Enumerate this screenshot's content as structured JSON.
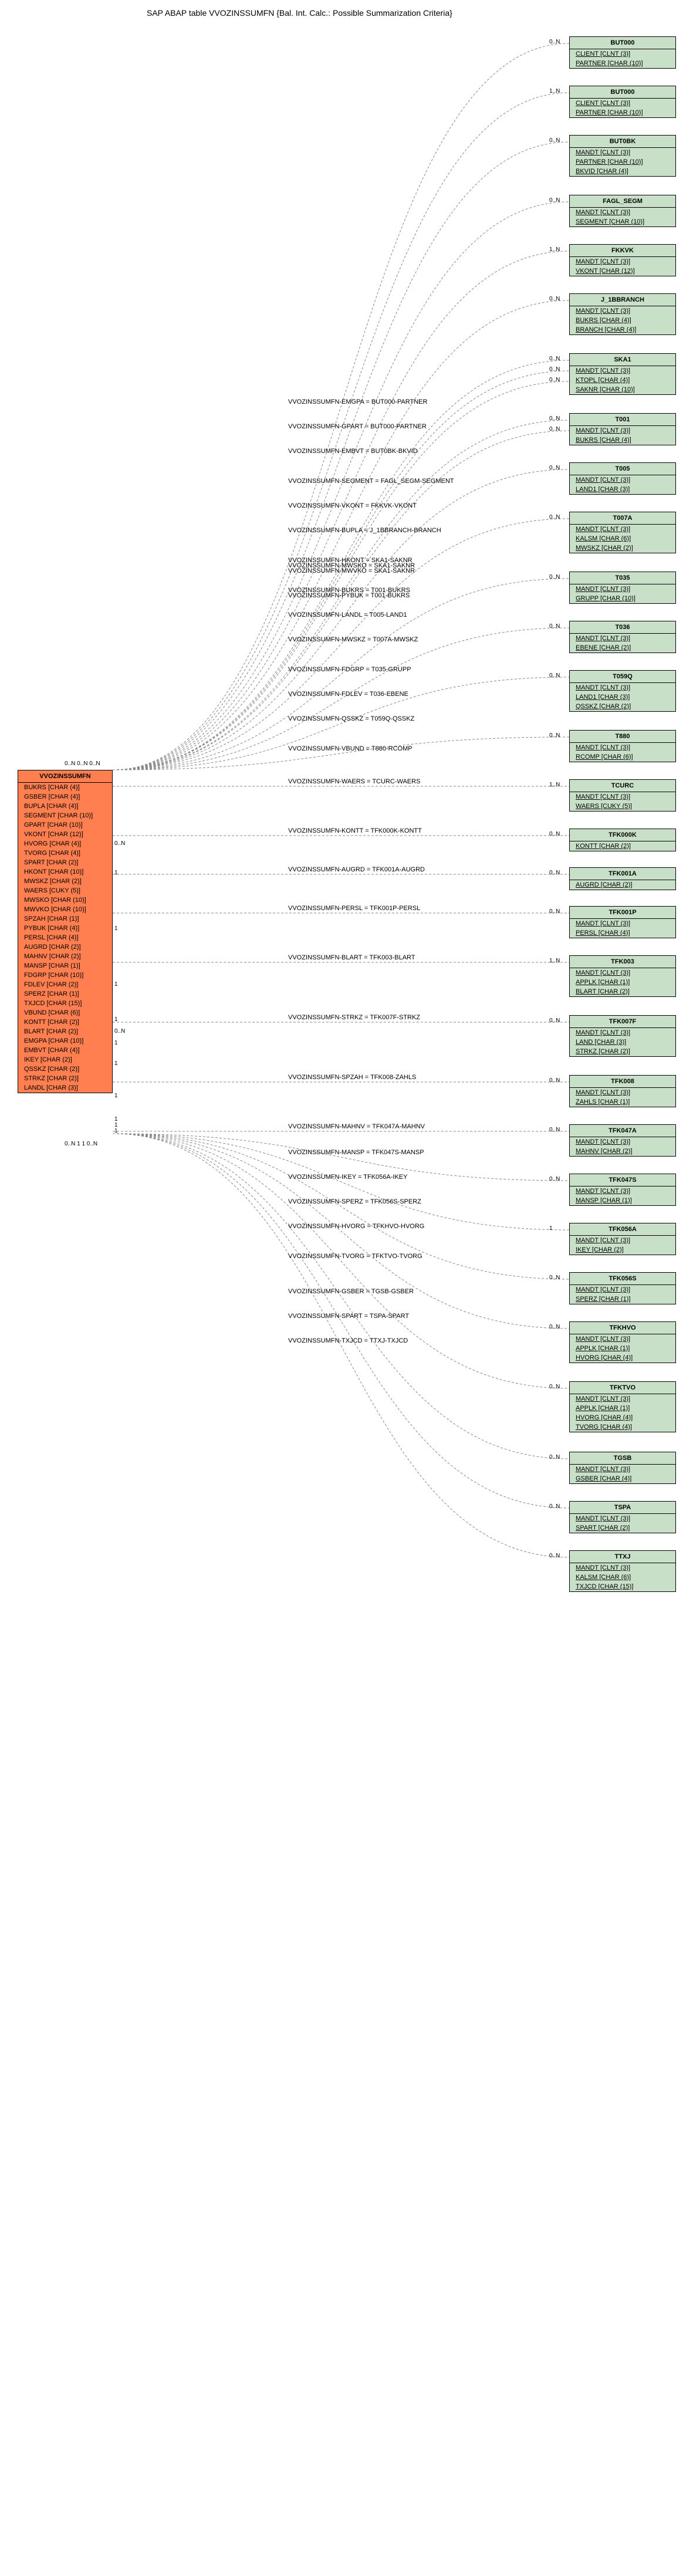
{
  "title": "SAP ABAP table VVOZINSSUMFN {Bal. Int. Calc.: Possible Summarization Criteria}",
  "main": {
    "name": "VVOZINSSUMFN",
    "fields": [
      "BUKRS [CHAR (4)]",
      "GSBER [CHAR (4)]",
      "BUPLA [CHAR (4)]",
      "SEGMENT [CHAR (10)]",
      "GPART [CHAR (10)]",
      "VKONT [CHAR (12)]",
      "HVORG [CHAR (4)]",
      "TVORG [CHAR (4)]",
      "SPART [CHAR (2)]",
      "HKONT [CHAR (10)]",
      "MWSKZ [CHAR (2)]",
      "WAERS [CUKY (5)]",
      "MWSKO [CHAR (10)]",
      "MWVKO [CHAR (10)]",
      "SPZAH [CHAR (1)]",
      "PYBUK [CHAR (4)]",
      "PERSL [CHAR (4)]",
      "AUGRD [CHAR (2)]",
      "MAHNV [CHAR (2)]",
      "MANSP [CHAR (1)]",
      "FDGRP [CHAR (10)]",
      "FDLEV [CHAR (2)]",
      "SPERZ [CHAR (1)]",
      "TXJCD [CHAR (15)]",
      "VBUND [CHAR (6)]",
      "KONTT [CHAR (2)]",
      "BLART [CHAR (2)]",
      "EMGPA [CHAR (10)]",
      "EMBVT [CHAR (4)]",
      "IKEY [CHAR (2)]",
      "QSSKZ [CHAR (2)]",
      "STRKZ [CHAR (2)]",
      "LANDL [CHAR (3)]"
    ]
  },
  "targets": [
    {
      "name": "BUT000",
      "fields": [
        "CLIENT [CLNT (3)]",
        "PARTNER [CHAR (10)]"
      ],
      "card": "0..N",
      "rel": "VVOZINSSUMFN-EMGPA = BUT000-PARTNER"
    },
    {
      "name": "BUT000",
      "fields": [
        "CLIENT [CLNT (3)]",
        "PARTNER [CHAR (10)]"
      ],
      "card": "1..N",
      "rel": "VVOZINSSUMFN-GPART = BUT000-PARTNER"
    },
    {
      "name": "BUT0BK",
      "fields": [
        "MANDT [CLNT (3)]",
        "PARTNER [CHAR (10)]",
        "BKVID [CHAR (4)]"
      ],
      "card": "0..N",
      "rel": "VVOZINSSUMFN-EMBVT = BUT0BK-BKVID"
    },
    {
      "name": "FAGL_SEGM",
      "fields": [
        "MANDT [CLNT (3)]",
        "SEGMENT [CHAR (10)]"
      ],
      "card": "0..N",
      "rel": "VVOZINSSUMFN-SEGMENT = FAGL_SEGM-SEGMENT"
    },
    {
      "name": "FKKVK",
      "fields": [
        "MANDT [CLNT (3)]",
        "VKONT [CHAR (12)]"
      ],
      "card": "1..N",
      "rel": "VVOZINSSUMFN-VKONT = FKKVK-VKONT"
    },
    {
      "name": "J_1BBRANCH",
      "fields": [
        "MANDT [CLNT (3)]",
        "BUKRS [CHAR (4)]",
        "BRANCH [CHAR (4)]"
      ],
      "card": "0..N",
      "rel": "VVOZINSSUMFN-BUPLA = J_1BBRANCH-BRANCH"
    },
    {
      "name": "SKA1",
      "fields": [
        "MANDT [CLNT (3)]",
        "KTOPL [CHAR (4)]",
        "SAKNR [CHAR (10)]"
      ],
      "card": [
        "0..N",
        "0..N",
        "0..N"
      ],
      "rel": [
        "VVOZINSSUMFN-HKONT = SKA1-SAKNR",
        "VVOZINSSUMFN-MWSKO = SKA1-SAKNR",
        "VVOZINSSUMFN-MWVKO = SKA1-SAKNR"
      ]
    },
    {
      "name": "T001",
      "fields": [
        "MANDT [CLNT (3)]",
        "BUKRS [CHAR (4)]"
      ],
      "card": [
        "0..N",
        "0..N"
      ],
      "rel": [
        "VVOZINSSUMFN-BUKRS = T001-BUKRS",
        "VVOZINSSUMFN-PYBUK = T001-BUKRS"
      ]
    },
    {
      "name": "T005",
      "fields": [
        "MANDT [CLNT (3)]",
        "LAND1 [CHAR (3)]"
      ],
      "card": "0..N",
      "rel": "VVOZINSSUMFN-LANDL = T005-LAND1"
    },
    {
      "name": "T007A",
      "fields": [
        "MANDT [CLNT (3)]",
        "KALSM [CHAR (6)]",
        "MWSKZ [CHAR (2)]"
      ],
      "card": "0..N",
      "rel": "VVOZINSSUMFN-MWSKZ = T007A-MWSKZ"
    },
    {
      "name": "T035",
      "fields": [
        "MANDT [CLNT (3)]",
        "GRUPP [CHAR (10)]"
      ],
      "card": "0..N",
      "rel": "VVOZINSSUMFN-FDGRP = T035-GRUPP"
    },
    {
      "name": "T036",
      "fields": [
        "MANDT [CLNT (3)]",
        "EBENE [CHAR (2)]"
      ],
      "card": "0..N",
      "rel": "VVOZINSSUMFN-FDLEV = T036-EBENE"
    },
    {
      "name": "T059Q",
      "fields": [
        "MANDT [CLNT (3)]",
        "LAND1 [CHAR (3)]",
        "QSSKZ [CHAR (2)]"
      ],
      "card": "0..N",
      "rel": "VVOZINSSUMFN-QSSKZ = T059Q-QSSKZ"
    },
    {
      "name": "T880",
      "fields": [
        "MANDT [CLNT (3)]",
        "RCOMP [CHAR (6)]"
      ],
      "card": "0..N",
      "rel": "VVOZINSSUMFN-VBUND = T880-RCOMP"
    },
    {
      "name": "TCURC",
      "fields": [
        "MANDT [CLNT (3)]",
        "WAERS [CUKY (5)]"
      ],
      "card": "1..N",
      "rel": "VVOZINSSUMFN-WAERS = TCURC-WAERS"
    },
    {
      "name": "TFK000K",
      "fields": [
        "KONTT [CHAR (2)]"
      ],
      "card": "0..N",
      "rel": "VVOZINSSUMFN-KONTT = TFK000K-KONTT"
    },
    {
      "name": "TFK001A",
      "fields": [
        "AUGRD [CHAR (2)]"
      ],
      "card": "0..N",
      "rel": "VVOZINSSUMFN-AUGRD = TFK001A-AUGRD"
    },
    {
      "name": "TFK001P",
      "fields": [
        "MANDT [CLNT (3)]",
        "PERSL [CHAR (4)]"
      ],
      "card": "0..N",
      "rel": "VVOZINSSUMFN-PERSL = TFK001P-PERSL"
    },
    {
      "name": "TFK003",
      "fields": [
        "MANDT [CLNT (3)]",
        "APPLK [CHAR (1)]",
        "BLART [CHAR (2)]"
      ],
      "card": "1..N",
      "rel": "VVOZINSSUMFN-BLART = TFK003-BLART"
    },
    {
      "name": "TFK007F",
      "fields": [
        "MANDT [CLNT (3)]",
        "LAND [CHAR (3)]",
        "STRKZ [CHAR (2)]"
      ],
      "card": "0..N",
      "rel": "VVOZINSSUMFN-STRKZ = TFK007F-STRKZ"
    },
    {
      "name": "TFK008",
      "fields": [
        "MANDT [CLNT (3)]",
        "ZAHLS [CHAR (1)]"
      ],
      "card": "0..N",
      "rel": "VVOZINSSUMFN-SPZAH = TFK008-ZAHLS"
    },
    {
      "name": "TFK047A",
      "fields": [
        "MANDT [CLNT (3)]",
        "MAHNV [CHAR (2)]"
      ],
      "card": "0..N",
      "rel": "VVOZINSSUMFN-MAHNV = TFK047A-MAHNV"
    },
    {
      "name": "TFK047S",
      "fields": [
        "MANDT [CLNT (3)]",
        "MANSP [CHAR (1)]"
      ],
      "card": "0..N",
      "rel": "VVOZINSSUMFN-MANSP = TFK047S-MANSP"
    },
    {
      "name": "TFK056A",
      "fields": [
        "MANDT [CLNT (3)]",
        "IKEY [CHAR (2)]"
      ],
      "card": "1",
      "rel": "VVOZINSSUMFN-IKEY = TFK056A-IKEY"
    },
    {
      "name": "TFK056S",
      "fields": [
        "MANDT [CLNT (3)]",
        "SPERZ [CHAR (1)]"
      ],
      "card": "0..N",
      "rel": "VVOZINSSUMFN-SPERZ = TFK056S-SPERZ"
    },
    {
      "name": "TFKHVO",
      "fields": [
        "MANDT [CLNT (3)]",
        "APPLK [CHAR (1)]",
        "HVORG [CHAR (4)]"
      ],
      "card": "0..N",
      "rel": "VVOZINSSUMFN-HVORG = TFKHVO-HVORG"
    },
    {
      "name": "TFKTVO",
      "fields": [
        "MANDT [CLNT (3)]",
        "APPLK [CHAR (1)]",
        "HVORG [CHAR (4)]",
        "TVORG [CHAR (4)]"
      ],
      "card": "0..N",
      "rel": "VVOZINSSUMFN-TVORG = TFKTVO-TVORG"
    },
    {
      "name": "TGSB",
      "fields": [
        "MANDT [CLNT (3)]",
        "GSBER [CHAR (4)]"
      ],
      "card": "0..N",
      "rel": "VVOZINSSUMFN-GSBER = TGSB-GSBER"
    },
    {
      "name": "TSPA",
      "fields": [
        "MANDT [CLNT (3)]",
        "SPART [CHAR (2)]"
      ],
      "card": "0..N",
      "rel": "VVOZINSSUMFN-SPART = TSPA-SPART"
    },
    {
      "name": "TTXJ",
      "fields": [
        "MANDT [CLNT (3)]",
        "KALSM [CHAR (6)]",
        "TXJCD [CHAR (15)]"
      ],
      "card": "0..N",
      "rel": "VVOZINSSUMFN-TXJCD = TTXJ-TXJCD"
    }
  ],
  "leftcards": {
    "top": "0..N 0..N 0..N",
    "mid": [
      "0..N",
      "1",
      "1",
      "1",
      "1",
      "0..N",
      "1",
      "1",
      "1",
      "1",
      "1",
      "1"
    ],
    "bot": "0..N 1 1 0..N"
  }
}
